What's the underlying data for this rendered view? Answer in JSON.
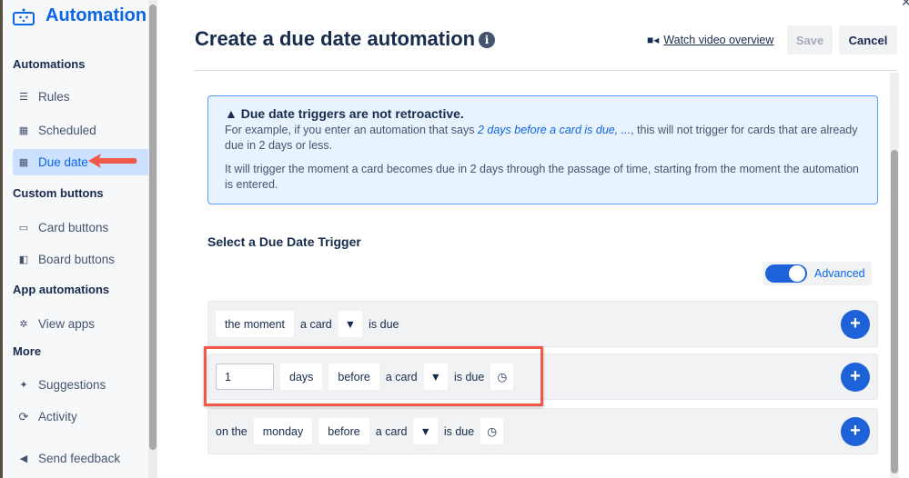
{
  "sidebar": {
    "title": "Automation",
    "sections": [
      {
        "heading": "Automations",
        "items": [
          {
            "label": "Rules",
            "icon": "sliders-icon"
          },
          {
            "label": "Scheduled",
            "icon": "calendar-icon"
          },
          {
            "label": "Due date",
            "icon": "calendar-icon",
            "active": true
          }
        ]
      },
      {
        "heading": "Custom buttons",
        "items": [
          {
            "label": "Card buttons",
            "icon": "card-icon"
          },
          {
            "label": "Board buttons",
            "icon": "board-icon"
          }
        ]
      },
      {
        "heading": "App automations",
        "items": [
          {
            "label": "View apps",
            "icon": "gear-icon"
          }
        ]
      },
      {
        "heading": "More",
        "items": [
          {
            "label": "Suggestions",
            "icon": "sparkle-icon"
          },
          {
            "label": "Activity",
            "icon": "refresh-icon"
          },
          {
            "label": "Send feedback",
            "icon": "megaphone-icon"
          }
        ]
      }
    ]
  },
  "header": {
    "title": "Create a due date automation",
    "watch_label": "Watch video overview",
    "save_label": "Save",
    "cancel_label": "Cancel"
  },
  "note": {
    "title": "Due date triggers are not retroactive.",
    "p1_pre": "For example, if you enter an automation that says ",
    "p1_em": "2 days before a card is due, ...",
    "p1_post": ", this will not trigger for cards that are already due in 2 days or less.",
    "p2": "It will trigger the moment a card becomes due in 2 days through the passage of time, starting from the moment the automation is entered."
  },
  "section_title": "Select a Due Date Trigger",
  "toggle": {
    "label": "Advanced",
    "on": true
  },
  "rows": {
    "r1": {
      "moment": "the moment",
      "a_card": "a card",
      "is_due": "is due"
    },
    "r2": {
      "value": "1",
      "unit": "days",
      "rel": "before",
      "a_card": "a card",
      "is_due": "is due"
    },
    "r3": {
      "on_the": "on the",
      "day": "monday",
      "rel": "before",
      "a_card": "a card",
      "is_due": "is due"
    }
  },
  "colors": {
    "accent": "#0c66e4",
    "highlight": "#f0584a"
  }
}
